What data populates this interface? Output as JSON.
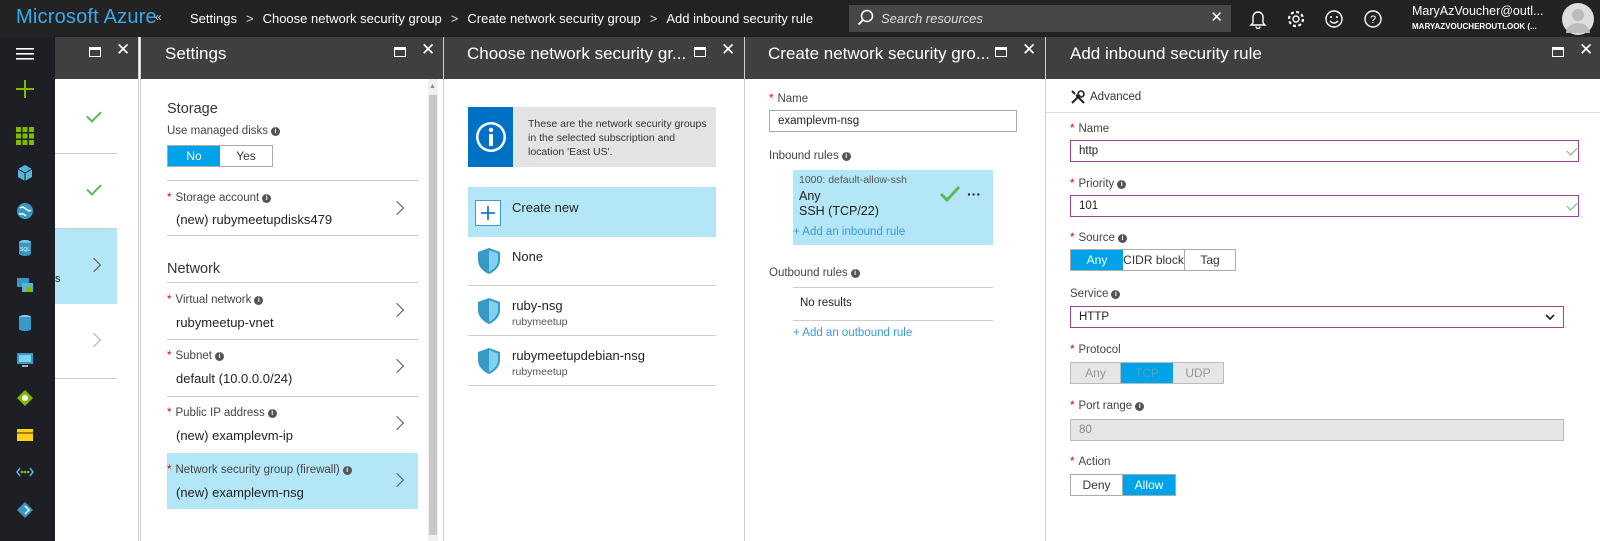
{
  "topbar": {
    "brand": "Microsoft Azure",
    "collapse": "«",
    "breadcrumbs": [
      "Settings",
      "Choose network security group",
      "Create network security group",
      "Add inbound security rule"
    ],
    "search_placeholder": "Search resources",
    "user_name": "MaryAzVoucher@outl...",
    "user_sub": "MARYAZVOUCHEROUTLOOK (..."
  },
  "settings": {
    "title": "Settings",
    "storage_heading": "Storage",
    "managed_disks_label": "Use managed disks",
    "managed_no": "No",
    "managed_yes": "Yes",
    "storage_account_label": "Storage account",
    "storage_account_value": "(new) rubymeetupdisks479",
    "network_heading": "Network",
    "vnet_label": "Virtual network",
    "vnet_value": "rubymeetup-vnet",
    "subnet_label": "Subnet",
    "subnet_value": "default (10.0.0.0/24)",
    "pip_label": "Public IP address",
    "pip_value": "(new) examplevm-ip",
    "nsg_label": "Network security group (firewall)",
    "nsg_value": "(new) examplevm-nsg"
  },
  "partial": {
    "fragment": "s"
  },
  "choose_nsg": {
    "title": "Choose network security gr...",
    "info_text": "These are the network security groups in the selected subscription and location 'East US'.",
    "create_new": "Create new",
    "items": [
      {
        "name": "None",
        "sub": ""
      },
      {
        "name": "ruby-nsg",
        "sub": "rubymeetup"
      },
      {
        "name": "rubymeetupdebian-nsg",
        "sub": "rubymeetup"
      }
    ]
  },
  "create_nsg": {
    "title": "Create network security gro...",
    "name_label": "Name",
    "name_value": "examplevm-nsg",
    "inbound_label": "Inbound rules",
    "rule_name": "1000: default-allow-ssh",
    "rule_source": "Any",
    "rule_port": "SSH (TCP/22)",
    "rule_more": "···",
    "add_inbound": "+ Add an inbound rule",
    "outbound_label": "Outbound rules",
    "no_results": "No results",
    "add_outbound": "+ Add an outbound rule"
  },
  "add_rule": {
    "title": "Add inbound security rule",
    "advanced": "Advanced",
    "name_label": "Name",
    "name_value": "http",
    "priority_label": "Priority",
    "priority_value": "101",
    "source_label": "Source",
    "source_options": [
      "Any",
      "CIDR block",
      "Tag"
    ],
    "service_label": "Service",
    "service_value": "HTTP",
    "protocol_label": "Protocol",
    "protocol_options": [
      "Any",
      "TCP",
      "UDP"
    ],
    "port_label": "Port range",
    "port_value": "80",
    "action_label": "Action",
    "action_deny": "Deny",
    "action_allow": "Allow"
  },
  "colors": {
    "accent": "#00a2e8",
    "selected_bg": "#b3e7f7",
    "nav_bg": "#1d1f24",
    "header_bg": "#3f3f3f",
    "topbar_bg": "#232323",
    "valid_green": "#5cb85c",
    "valid_border": "#a1408f"
  }
}
